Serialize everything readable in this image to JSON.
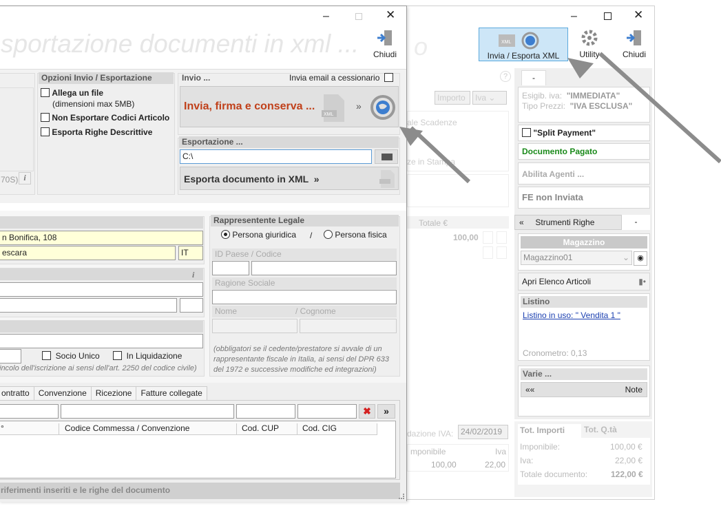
{
  "back": {
    "toolbar": {
      "send_label": "Invia / Esporta XML",
      "utility_label": "Utility",
      "close_label": "Chiudi"
    },
    "title_partial": "o",
    "help_glyph": "?",
    "filter": {
      "importo": "Importo",
      "iva": "Iva"
    },
    "texts": {
      "scadenze": "ale Scadenze",
      "stampa": "ze in Stampa"
    },
    "table_header": {
      "totale": "Totale €"
    },
    "row_value": "100,00",
    "date_label": "dazione IVA:",
    "date_value": "24/02/2019",
    "bottom_table": {
      "imponibile": "mponibile",
      "iva": "Iva",
      "imponibile_val": "100,00",
      "iva_val": "22,00"
    },
    "side": {
      "tab_label": "-",
      "esigib_label": "Esigib. iva:",
      "esigib_val": "\"IMMEDIATA\"",
      "tipo_label": "Tipo Prezzi:",
      "tipo_val": "\"IVA ESCLUSA\"",
      "split_payment": "\"Split Payment\"",
      "pagato": "Documento Pagato",
      "agenti": "Abilita Agenti ...",
      "fe": "FE non Inviata",
      "strumenti_prefix": "«",
      "strumenti": "Strumenti Righe",
      "strumenti_tab": "-",
      "magazzino_header": "Magazzino",
      "magazzino_val": "Magazzino01",
      "apri": "Apri Elenco Articoli",
      "listino_header": "Listino",
      "listino_link": "Listino in uso: \" Vendita 1 \"",
      "cronometro": "Cronometro: 0,13",
      "varie_header": "Varie ...",
      "varie_prefix": "«« ",
      "note": "Note",
      "tot_importi": "Tot. Importi",
      "tot_qta": "Tot. Q.tà",
      "imponibile_lbl": "Imponibile:",
      "imponibile_val": "100,00 €",
      "iva_lbl": "Iva:",
      "iva_val": "22,00 €",
      "totale_lbl": "Totale documento:",
      "totale_val": "122,00 €"
    }
  },
  "front": {
    "title": "sportazione documenti in xml ...",
    "close_label": "Chiudi",
    "opzioni_header": "Opzioni Invio / Esportazione",
    "allega": "Allega un file",
    "allega_sub": "(dimensioni max 5MB)",
    "non_esportare": "Non Esportare Codici Articolo",
    "esporta_righe": "Esporta Righe Descrittive",
    "left_frag": "70S)",
    "invio_header": "Invio ...",
    "invio_email": "Invia email a cessionario",
    "invia_button": "Invia, firma e conserva ...",
    "invia_arrow": "»",
    "esportazione_header": "Esportazione ...",
    "path_value": "C:\\",
    "esporta_button": "Esporta documento in XML  »",
    "address": "n Bonifica, 108",
    "city": "escara",
    "country": "IT",
    "rappresentante_header": "Rappresentente Legale",
    "persona_giuridica": "Persona giuridica",
    "sep": "/",
    "persona_fisica": "Persona fisica",
    "id_paese": "ID Paese / Codice",
    "ragione": "Ragione Sociale",
    "nome": "Nome",
    "cognome": "/ Cognome",
    "socio_unico": "Socio Unico",
    "liquidazione": "In Liquidazione",
    "iscrizione_note": "incolo dell'iscrizione ai sensi dell'art. 2250 del codice civile)",
    "obbligatori_note": "(obbligatori se il cedente/prestatore si avvale di un rappresentante fiscale in Italia, ai sensi del DPR 633 del 1972 e successive modifiche ed integrazioni)",
    "tabs": [
      "ontratto",
      "Convenzione",
      "Ricezione",
      "Fatture collegate"
    ],
    "col_headers": [
      "°",
      "Codice Commessa / Convenzione",
      "Cod. CUP",
      "Cod. CIG"
    ],
    "more_btn": "»",
    "footer": "riferimenti inseriti e le righe del documento"
  },
  "colors": {
    "accent_orange": "#c0401a",
    "link_blue": "#1a3fb0",
    "green": "#1a8a1a"
  }
}
